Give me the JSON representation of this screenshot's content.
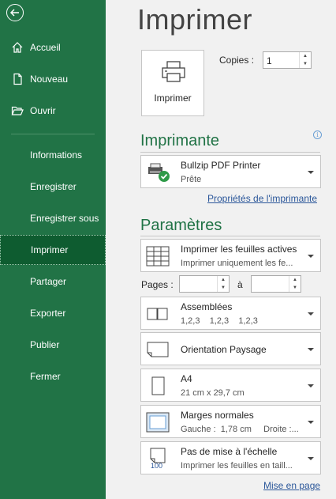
{
  "sidebar": {
    "items": [
      {
        "label": "Accueil",
        "icon": "home-icon"
      },
      {
        "label": "Nouveau",
        "icon": "new-document-icon"
      },
      {
        "label": "Ouvrir",
        "icon": "folder-open-icon"
      },
      {
        "label": "Informations"
      },
      {
        "label": "Enregistrer"
      },
      {
        "label": "Enregistrer sous"
      },
      {
        "label": "Imprimer",
        "active": true
      },
      {
        "label": "Partager"
      },
      {
        "label": "Exporter"
      },
      {
        "label": "Publier"
      },
      {
        "label": "Fermer"
      }
    ]
  },
  "page_title": "Imprimer",
  "print_button": {
    "label": "Imprimer"
  },
  "copies": {
    "label": "Copies :",
    "value": "1"
  },
  "printer": {
    "heading": "Imprimante",
    "name": "Bullzip PDF Printer",
    "status": "Prête",
    "properties_link": "Propriétés de l'imprimante"
  },
  "settings": {
    "heading": "Paramètres",
    "print_what": {
      "title": "Imprimer les feuilles actives",
      "subtitle": "Imprimer uniquement les fe..."
    },
    "pages_label": "Pages :",
    "to_label": "à",
    "pages_from": "",
    "pages_to": "",
    "collation": {
      "title": "Assemblées",
      "subtitle": "1,2,3    1,2,3    1,2,3"
    },
    "orientation": {
      "title": "Orientation Paysage"
    },
    "paper": {
      "title": "A4",
      "subtitle": "21 cm x 29,7 cm"
    },
    "margins": {
      "title": "Marges normales",
      "subtitle": "Gauche :  1,78 cm     Droite :..."
    },
    "scaling": {
      "title": "Pas de mise à l'échelle",
      "subtitle": "Imprimer les feuilles en taill..."
    },
    "page_setup_link": "Mise en page"
  },
  "colors": {
    "sidebar": "#217346",
    "active": "#0e5c30",
    "heading": "#217346",
    "link": "#2b579a"
  }
}
